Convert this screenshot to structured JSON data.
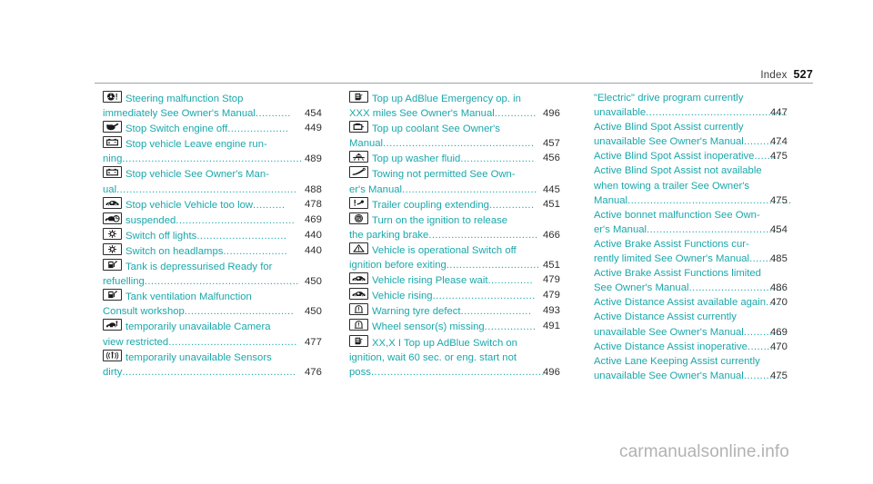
{
  "header": {
    "label": "Index",
    "page_number": "527"
  },
  "colors": {
    "entry_text": "#1aa7ab",
    "page_number": "#2e2e2e",
    "rule": "#9aa4a6",
    "watermark": "#b2b2b2"
  },
  "watermark": "carmanualsonline.info",
  "columns": [
    {
      "id": "column-1",
      "entries": [
        {
          "icon": "steering-wheel-warning-icon",
          "lines": [
            {
              "text": "Steering malfunction Stop",
              "leader": "",
              "page": ""
            },
            {
              "text": "immediately See Owner's Manual",
              "leader": "...........",
              "page": "454"
            }
          ]
        },
        {
          "icon": "engine-oil-can-icon",
          "lines": [
            {
              "text": "Stop Switch engine off",
              "leader": "...................",
              "page": "449"
            }
          ]
        },
        {
          "icon": "battery-icon",
          "lines": [
            {
              "text": "Stop vehicle Leave engine run-",
              "leader": "",
              "page": ""
            },
            {
              "text": "ning",
              "leader": "........................................................",
              "page": "489"
            }
          ]
        },
        {
          "icon": "battery-icon",
          "lines": [
            {
              "text": "Stop vehicle See Owner's Man-",
              "leader": "",
              "page": ""
            },
            {
              "text": "ual",
              "leader": "........................................................",
              "page": "488"
            }
          ]
        },
        {
          "icon": "car-lowered-icon",
          "lines": [
            {
              "text": "Stop vehicle Vehicle too low",
              "leader": "..........",
              "page": "478"
            }
          ]
        },
        {
          "icon": "car-suspension-icon",
          "lines": [
            {
              "text": "suspended",
              "leader": ".....................................",
              "page": "469"
            }
          ]
        },
        {
          "icon": "lamp-icon",
          "lines": [
            {
              "text": "Switch off lights",
              "leader": "............................",
              "page": "440"
            }
          ]
        },
        {
          "icon": "lamp-icon",
          "lines": [
            {
              "text": "Switch on headlamps",
              "leader": "....................",
              "page": "440"
            }
          ]
        },
        {
          "icon": "fuel-pump-icon",
          "lines": [
            {
              "text": "Tank is depressurised Ready for",
              "leader": "",
              "page": ""
            },
            {
              "text": "refuelling",
              "leader": "................................................",
              "page": "450"
            }
          ]
        },
        {
          "icon": "fuel-pump-icon",
          "lines": [
            {
              "text": "Tank ventilation Malfunction",
              "leader": "",
              "page": ""
            },
            {
              "text": "Consult workshop",
              "leader": "..................................",
              "page": "450"
            }
          ]
        },
        {
          "icon": "camera-car-icon",
          "lines": [
            {
              "text": "temporarily unavailable Camera",
              "leader": "",
              "page": ""
            },
            {
              "text": "view restricted",
              "leader": "........................................",
              "page": "477"
            }
          ]
        },
        {
          "icon": "sensor-icon",
          "lines": [
            {
              "text": "temporarily unavailable Sensors",
              "leader": "",
              "page": ""
            },
            {
              "text": "dirty",
              "leader": "......................................................",
              "page": "476"
            }
          ]
        }
      ]
    },
    {
      "id": "column-2",
      "entries": [
        {
          "icon": "adblue-canister-icon",
          "lines": [
            {
              "text": "Top up AdBlue Emergency op. in",
              "leader": "",
              "page": ""
            },
            {
              "text": "XXX miles See Owner's Manual",
              "leader": ".............",
              "page": "496"
            }
          ]
        },
        {
          "icon": "coolant-icon",
          "lines": [
            {
              "text": "Top up coolant See Owner's",
              "leader": "",
              "page": ""
            },
            {
              "text": "Manual",
              "leader": "...............................................",
              "page": "457"
            }
          ]
        },
        {
          "icon": "washer-fluid-icon",
          "lines": [
            {
              "text": "Top up washer fluid",
              "leader": ".......................",
              "page": "456"
            }
          ]
        },
        {
          "icon": "towing-hook-icon",
          "lines": [
            {
              "text": "Towing not permitted See Own-",
              "leader": "",
              "page": ""
            },
            {
              "text": "er's Manual",
              "leader": "..........................................",
              "page": "445"
            }
          ]
        },
        {
          "icon": "trailer-coupling-icon",
          "lines": [
            {
              "text": "Trailer coupling extending",
              "leader": "..............",
              "page": "451"
            }
          ]
        },
        {
          "icon": "parking-brake-icon",
          "lines": [
            {
              "text": "Turn on the ignition to release",
              "leader": "",
              "page": ""
            },
            {
              "text": "the parking brake",
              "leader": "..................................",
              "page": "466"
            }
          ]
        },
        {
          "icon": "warning-triangle-icon",
          "lines": [
            {
              "text": "Vehicle is operational Switch off",
              "leader": "",
              "page": ""
            },
            {
              "text": "ignition before exiting",
              "leader": ".............................",
              "page": "451"
            }
          ]
        },
        {
          "icon": "car-raised-icon",
          "lines": [
            {
              "text": "Vehicle rising Please wait",
              "leader": "..............",
              "page": "479"
            }
          ]
        },
        {
          "icon": "car-raised-icon",
          "lines": [
            {
              "text": "Vehicle rising",
              "leader": "................................",
              "page": "479"
            }
          ]
        },
        {
          "icon": "tyre-pressure-icon",
          "lines": [
            {
              "text": "Warning tyre defect",
              "leader": "......................",
              "page": "493"
            }
          ]
        },
        {
          "icon": "tyre-pressure-icon",
          "lines": [
            {
              "text": "Wheel sensor(s) missing",
              "leader": "................",
              "page": "491"
            }
          ]
        },
        {
          "icon": "adblue-canister-icon",
          "lines": [
            {
              "text": "XX,X I Top up AdBlue Switch on",
              "leader": "",
              "page": ""
            },
            {
              "text": "ignition, wait 60 sec. or eng. start not",
              "leader": "",
              "page": ""
            },
            {
              "text": "poss",
              "leader": "......................................................",
              "page": "496"
            }
          ]
        }
      ]
    },
    {
      "id": "column-3",
      "entries": [
        {
          "icon": "",
          "lines": [
            {
              "text": "\"Electric\" drive program currently",
              "leader": "",
              "page": ""
            },
            {
              "text": "unavailable",
              "leader": "............................................",
              "page": "447"
            }
          ]
        },
        {
          "icon": "",
          "lines": [
            {
              "text": "Active Blind Spot Assist currently",
              "leader": "",
              "page": ""
            },
            {
              "text": "unavailable See Owner's Manual",
              "leader": "............",
              "page": "474"
            }
          ]
        },
        {
          "icon": "",
          "lines": [
            {
              "text": "Active Blind Spot Assist inoperative",
              "leader": "........",
              "page": "475"
            }
          ]
        },
        {
          "icon": "",
          "lines": [
            {
              "text": "Active Blind Spot Assist not available",
              "leader": "",
              "page": ""
            },
            {
              "text": "when towing a trailer See Owner's",
              "leader": "",
              "page": ""
            },
            {
              "text": "Manual",
              "leader": "...................................................",
              "page": "475"
            }
          ]
        },
        {
          "icon": "",
          "lines": [
            {
              "text": "Active bonnet malfunction See Own-",
              "leader": "",
              "page": ""
            },
            {
              "text": "er's Manual",
              "leader": "..........................................",
              "page": "454"
            }
          ]
        },
        {
          "icon": "",
          "lines": [
            {
              "text": "Active Brake Assist Functions cur-",
              "leader": "",
              "page": ""
            },
            {
              "text": "rently limited See Owner's Manual",
              "leader": "........",
              "page": "485"
            }
          ]
        },
        {
          "icon": "",
          "lines": [
            {
              "text": "Active Brake Assist Functions limited",
              "leader": "",
              "page": ""
            },
            {
              "text": "See Owner's Manual",
              "leader": ".............................",
              "page": "486"
            }
          ]
        },
        {
          "icon": "",
          "lines": [
            {
              "text": "Active Distance Assist available again",
              "leader": ".....",
              "page": "470"
            }
          ]
        },
        {
          "icon": "",
          "lines": [
            {
              "text": "Active Distance Assist currently",
              "leader": "",
              "page": ""
            },
            {
              "text": "unavailable See Owner's Manual",
              "leader": "............",
              "page": "469"
            }
          ]
        },
        {
          "icon": "",
          "lines": [
            {
              "text": "Active Distance Assist inoperative",
              "leader": "..........",
              "page": "470"
            }
          ]
        },
        {
          "icon": "",
          "lines": [
            {
              "text": "Active Lane Keeping Assist currently",
              "leader": "",
              "page": ""
            },
            {
              "text": "unavailable See Owner's Manual",
              "leader": "............",
              "page": "475"
            }
          ]
        }
      ]
    }
  ]
}
